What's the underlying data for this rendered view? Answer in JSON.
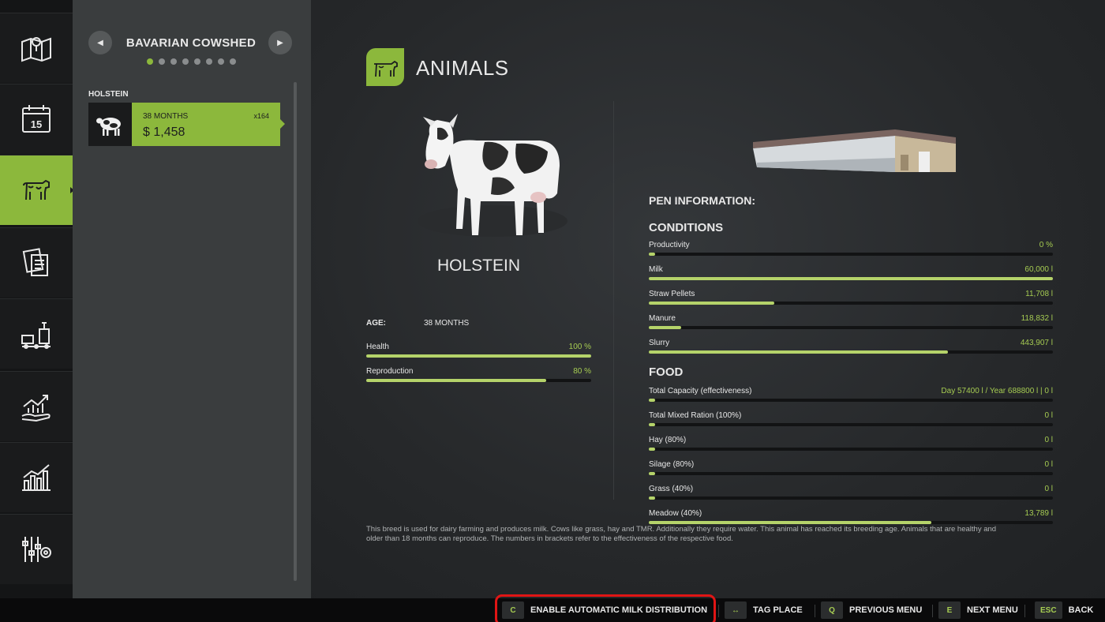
{
  "sidebar": {
    "items": [
      {
        "id": "map",
        "icon": "map-pin-icon"
      },
      {
        "id": "calendar",
        "icon": "calendar-icon",
        "text": "15"
      },
      {
        "id": "animals",
        "icon": "cow-icon",
        "active": true
      },
      {
        "id": "contracts",
        "icon": "documents-icon"
      },
      {
        "id": "production",
        "icon": "factory-icon"
      },
      {
        "id": "finances",
        "icon": "growth-hand-icon"
      },
      {
        "id": "statistics",
        "icon": "bar-chart-icon"
      },
      {
        "id": "settings",
        "icon": "sliders-gear-icon"
      }
    ]
  },
  "list_panel": {
    "header": "BAVARIAN COWSHED",
    "page_dots": 8,
    "active_dot": 0,
    "group_label": "HOLSTEIN",
    "card": {
      "months": "38 MONTHS",
      "count": "x164",
      "price": "$ 1,458"
    }
  },
  "main": {
    "title": "ANIMALS",
    "breed": "HOLSTEIN",
    "age_label": "AGE:",
    "age_value": "38 MONTHS",
    "animal_stats": [
      {
        "label": "Health",
        "value": "100 %",
        "fill": 1.0
      },
      {
        "label": "Reproduction",
        "value": "80 %",
        "fill": 0.8
      }
    ],
    "pen_info_label": "PEN INFORMATION:",
    "conditions_label": "CONDITIONS",
    "conditions": [
      {
        "label": "Productivity",
        "value": "0 %",
        "fill": 0.01
      },
      {
        "label": "Milk",
        "value": "60,000 l",
        "fill": 1.0
      },
      {
        "label": "Straw Pellets",
        "value": "11,708 l",
        "fill": 0.31
      },
      {
        "label": "Manure",
        "value": "118,832 l",
        "fill": 0.08
      },
      {
        "label": "Slurry",
        "value": "443,907 l",
        "fill": 0.74
      }
    ],
    "food_label": "FOOD",
    "food": [
      {
        "label": "Total Capacity (effectiveness)",
        "value": "Day 57400 l / Year 688800 l  |  0 l",
        "fill": 0.01
      },
      {
        "label": "Total Mixed Ration (100%)",
        "value": "0 l",
        "fill": 0.01
      },
      {
        "label": "Hay (80%)",
        "value": "0 l",
        "fill": 0.01
      },
      {
        "label": "Silage (80%)",
        "value": "0 l",
        "fill": 0.01
      },
      {
        "label": "Grass (40%)",
        "value": "0 l",
        "fill": 0.01
      },
      {
        "label": "Meadow (40%)",
        "value": "13,789 l",
        "fill": 0.7
      }
    ],
    "description": "This breed is used for dairy farming and produces milk. Cows like grass, hay and TMR. Additionally they require water. This animal has reached its breeding age. Animals that are healthy and older than 18 months can reproduce. The numbers in brackets refer to the effectiveness of the respective food."
  },
  "bottom_hints": [
    {
      "key": "C",
      "label": "ENABLE AUTOMATIC MILK DISTRIBUTION"
    },
    {
      "key": "↔",
      "label": "TAG PLACE"
    },
    {
      "key": "Q",
      "label": "PREVIOUS MENU"
    },
    {
      "key": "E",
      "label": "NEXT MENU"
    },
    {
      "key": "ESC",
      "label": "BACK"
    }
  ],
  "colors": {
    "accent": "#8cb83c",
    "value_text": "#a6cc52",
    "highlight": "#e01515"
  }
}
